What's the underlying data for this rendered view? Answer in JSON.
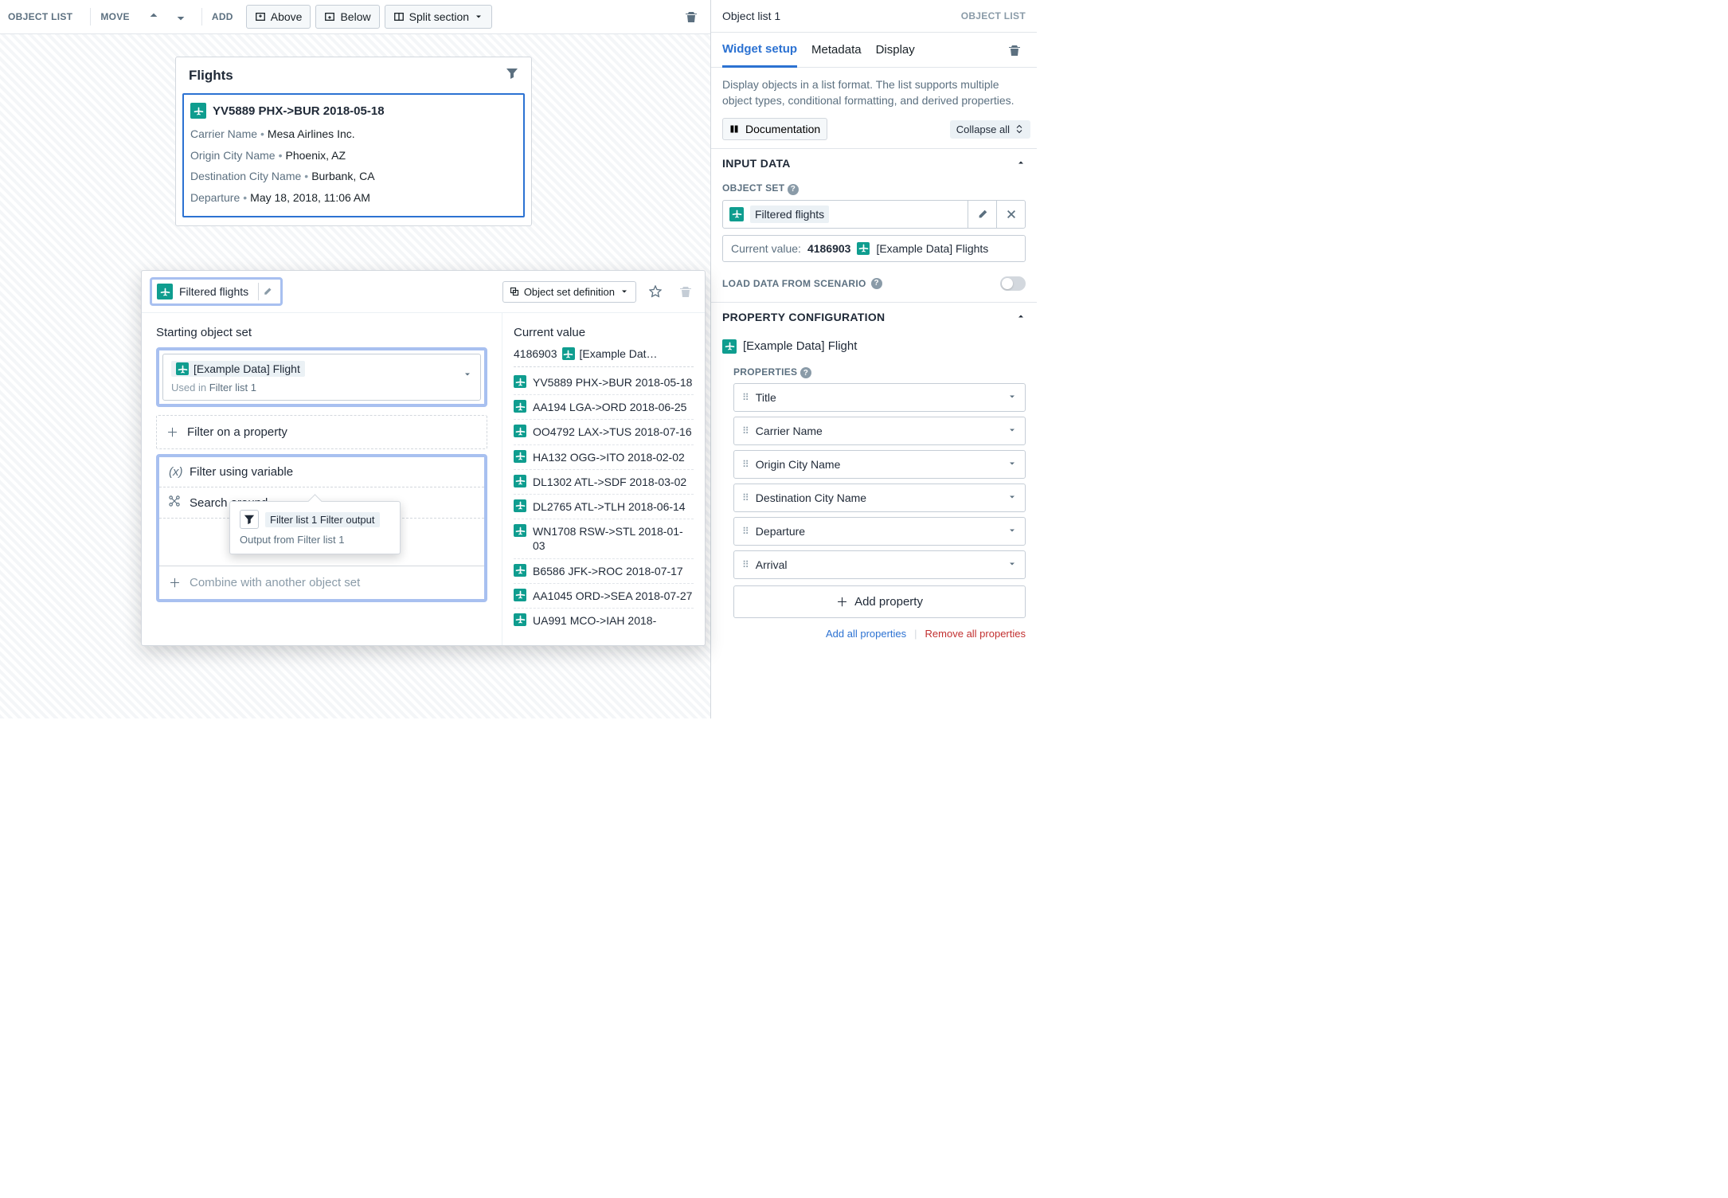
{
  "toolbar": {
    "object_list_label": "OBJECT LIST",
    "move_label": "MOVE",
    "add_label": "ADD",
    "above": "Above",
    "below": "Below",
    "split": "Split section"
  },
  "card": {
    "title": "Flights",
    "item": {
      "title": "YV5889 PHX->BUR 2018-05-18",
      "carrier_label": "Carrier Name",
      "carrier_value": "Mesa Airlines Inc.",
      "origin_label": "Origin City Name",
      "origin_value": "Phoenix, AZ",
      "dest_label": "Destination City Name",
      "dest_value": "Burbank, CA",
      "dep_label": "Departure",
      "dep_value": "May 18, 2018, 11:06 AM"
    }
  },
  "popover": {
    "name": "Filtered flights",
    "osd_button": "Object set definition",
    "starting_label": "Starting object set",
    "starting_chip": "[Example Data] Flight",
    "used_in_prefix": "Used in",
    "used_in_link": "Filter list 1",
    "filter_property": "Filter on a property",
    "filter_variable": "Filter using variable",
    "search_around": "Search around",
    "combine": "Combine with another object set",
    "current_value_label": "Current value",
    "count": "4186903",
    "count_label": "[Example Dat…",
    "rows": [
      "YV5889 PHX->BUR 2018-05-18",
      "AA194 LGA->ORD 2018-06-25",
      "OO4792 LAX->TUS 2018-07-16",
      "HA132 OGG->ITO 2018-02-02",
      "DL1302 ATL->SDF 2018-03-02",
      "DL2765 ATL->TLH 2018-06-14",
      "WN1708 RSW->STL 2018-01-03",
      "B6586 JFK->ROC 2018-07-17",
      "AA1045 ORD->SEA 2018-07-27",
      "UA991 MCO->IAH 2018-"
    ]
  },
  "tooltip": {
    "label": "Filter list 1 Filter output",
    "sub_prefix": "Output from",
    "sub_link": "Filter list 1"
  },
  "panel": {
    "title": "Object list 1",
    "type": "OBJECT LIST",
    "tabs": {
      "setup": "Widget setup",
      "metadata": "Metadata",
      "display": "Display"
    },
    "description": "Display objects in a list format. The list supports multiple object types, conditional formatting, and derived properties.",
    "documentation": "Documentation",
    "collapse_all": "Collapse all",
    "input_data_hdr": "INPUT DATA",
    "object_set_label": "OBJECT SET",
    "object_set_value": "Filtered flights",
    "current_value_label": "Current value:",
    "current_value_count": "4186903",
    "current_value_name": "[Example Data] Flights",
    "load_scenario": "LOAD DATA FROM SCENARIO",
    "prop_config_hdr": "PROPERTY CONFIGURATION",
    "object_type": "[Example Data] Flight",
    "properties_label": "PROPERTIES",
    "properties": [
      "Title",
      "Carrier Name",
      "Origin City Name",
      "Destination City Name",
      "Departure",
      "Arrival"
    ],
    "add_property": "Add property",
    "add_all": "Add all properties",
    "remove_all": "Remove all properties"
  }
}
